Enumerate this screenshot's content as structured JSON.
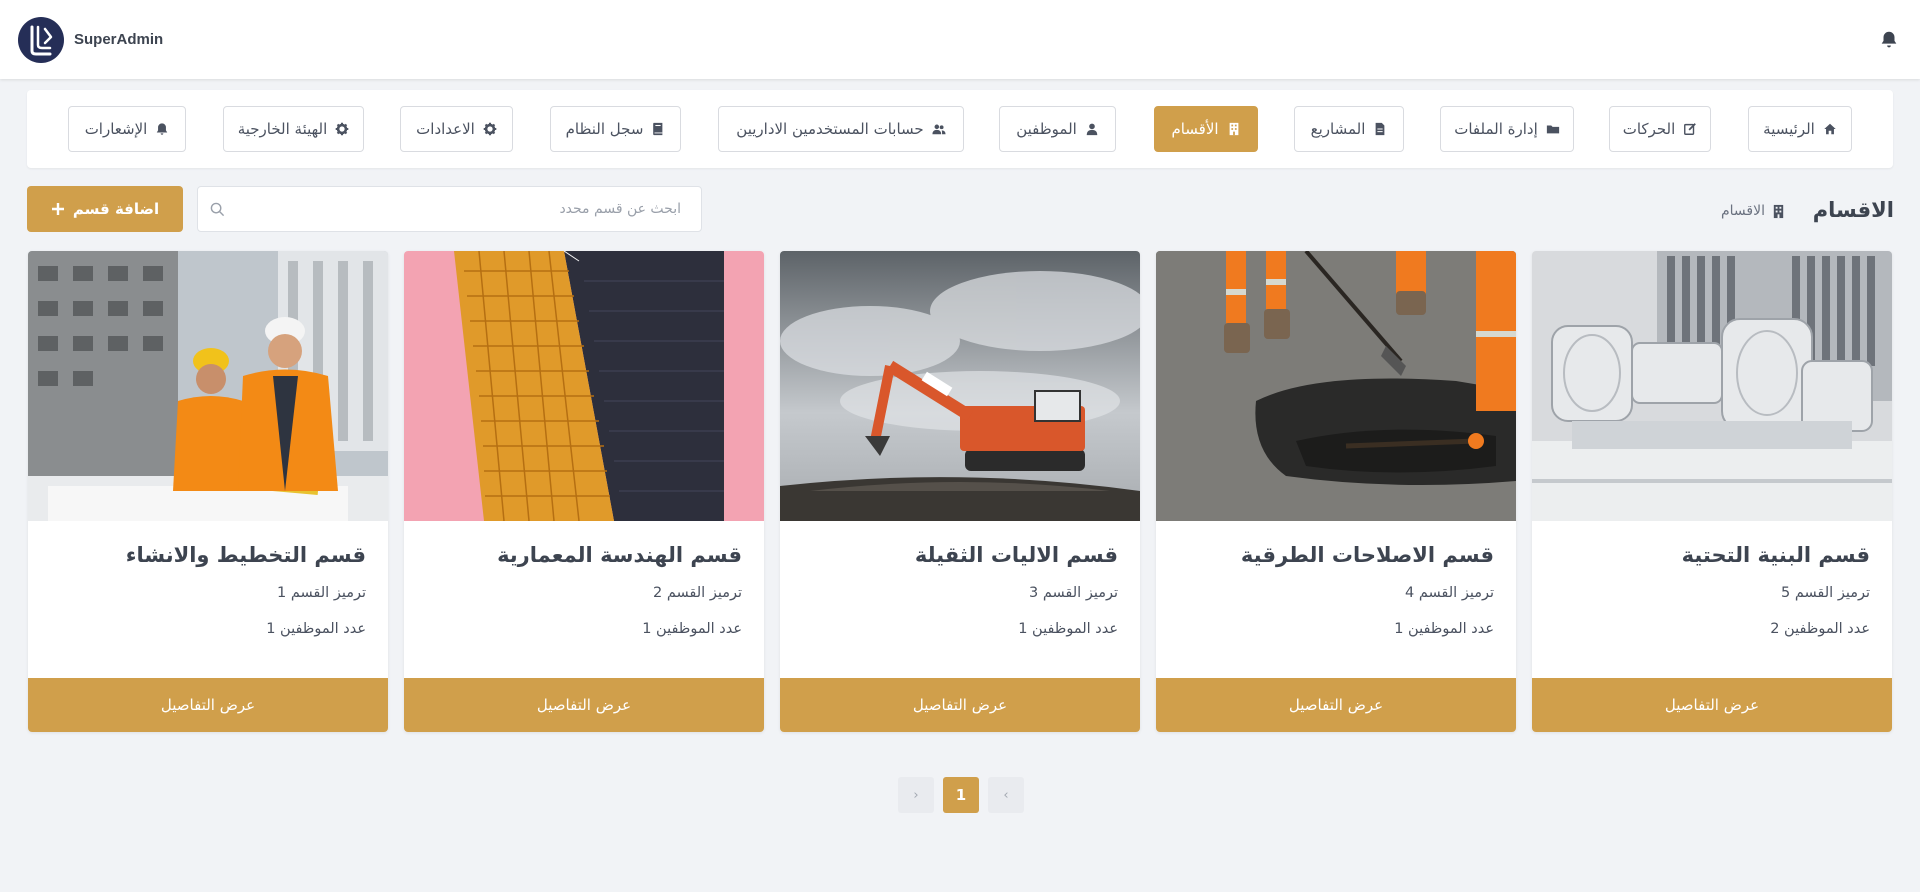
{
  "app": {
    "brand_name": "SuperAdmin"
  },
  "nav": {
    "items": [
      {
        "label": "الرئيسية",
        "icon": "home-icon",
        "active": false
      },
      {
        "label": "الحركات",
        "icon": "edit-icon",
        "active": false
      },
      {
        "label": "إدارة الملفات",
        "icon": "folder-icon",
        "active": false
      },
      {
        "label": "المشاريع",
        "icon": "file-icon",
        "active": false
      },
      {
        "label": "الأقسام",
        "icon": "building-icon",
        "active": true
      },
      {
        "label": "الموظفين",
        "icon": "user-icon",
        "active": false
      },
      {
        "label": "حسابات المستخدمين الاداريين",
        "icon": "users-icon",
        "active": false
      },
      {
        "label": "سجل النظام",
        "icon": "book-icon",
        "active": false
      },
      {
        "label": "الاعدادات",
        "icon": "gear-icon",
        "active": false
      },
      {
        "label": "الهيئة الخارجية",
        "icon": "gear-icon",
        "active": false
      },
      {
        "label": "الإشعارات",
        "icon": "bell-icon",
        "active": false
      }
    ]
  },
  "page": {
    "title": "الاقسام",
    "breadcrumb": "الاقسام",
    "search_placeholder": "ابحث عن قسم محدد",
    "add_button": "اضافة قسم"
  },
  "cards": [
    {
      "title": "قسم البنية التحتية",
      "code_line": "ترميز القسم 5",
      "employees_line": "عدد الموظفين 2",
      "button": "عرض التفاصيل",
      "image": "industrial-ducts-image"
    },
    {
      "title": "قسم الاصلاحات الطرقية",
      "code_line": "ترميز القسم 4",
      "employees_line": "عدد الموظفين 1",
      "button": "عرض التفاصيل",
      "image": "road-asphalt-workers-image"
    },
    {
      "title": "قسم الاليات الثقيلة",
      "code_line": "ترميز القسم 3",
      "employees_line": "عدد الموظفين 1",
      "button": "عرض التفاصيل",
      "image": "excavator-image"
    },
    {
      "title": "قسم الهندسة المعمارية",
      "code_line": "ترميز القسم 2",
      "employees_line": "عدد الموظفين 1",
      "button": "عرض التفاصيل",
      "image": "glass-tower-image"
    },
    {
      "title": "قسم التخطيط والانشاء",
      "code_line": "ترميز القسم 1",
      "employees_line": "عدد الموظفين 1",
      "button": "عرض التفاصيل",
      "image": "construction-engineers-image"
    }
  ],
  "pagination": {
    "current": "1",
    "prev_symbol": "‹",
    "next_symbol": "›"
  },
  "colors": {
    "accent": "#d09f4b",
    "logo_bg": "#252e57",
    "background": "#f1f3f6"
  }
}
